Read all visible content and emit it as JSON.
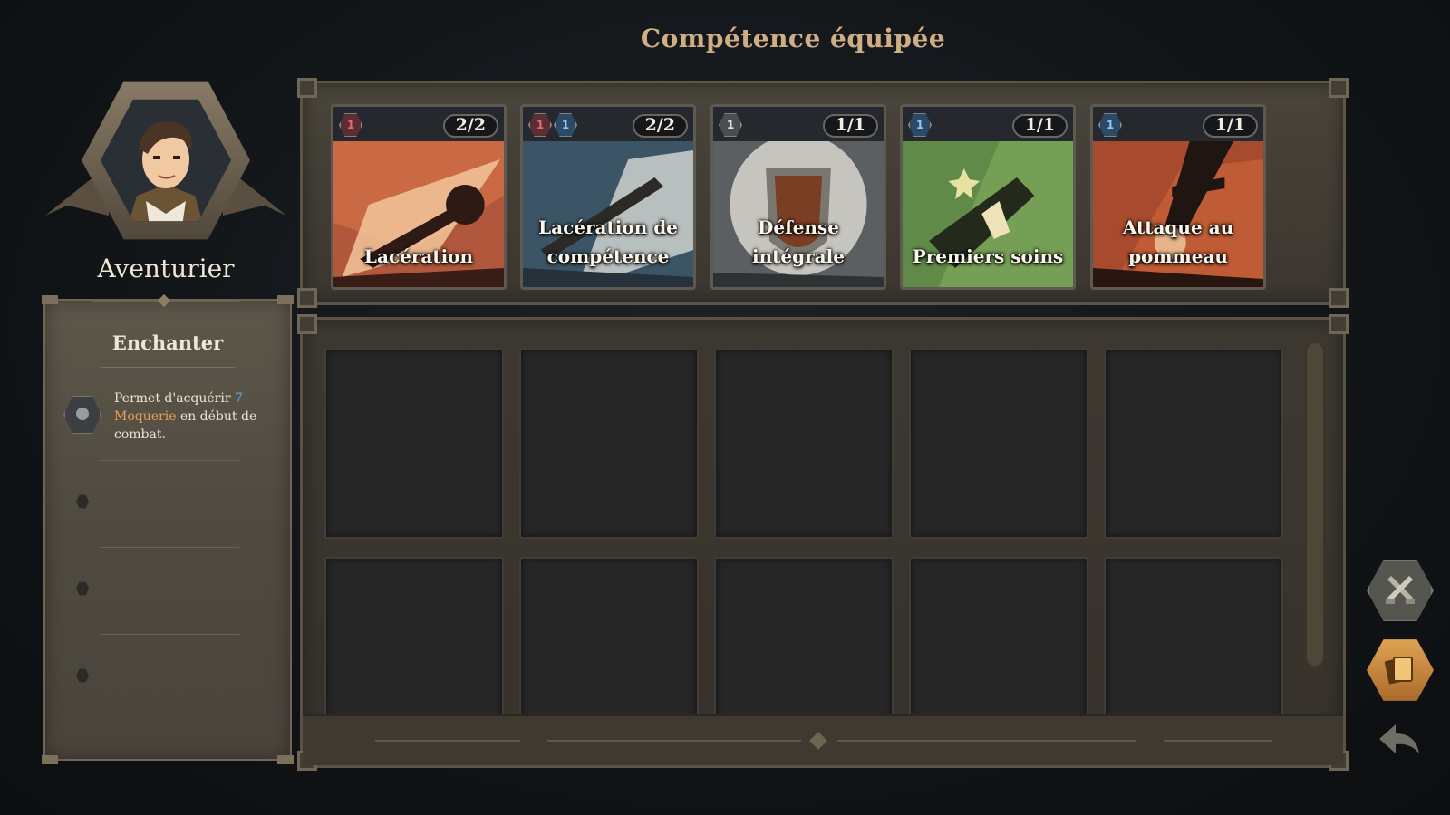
{
  "header": {
    "title": "Compétence équipée"
  },
  "character": {
    "name": "Aventurier"
  },
  "trait_panel": {
    "title": "Enchanter",
    "trait": {
      "icon": "mask-icon",
      "text_before": "Permet d'acquérir ",
      "count": "7",
      "keyword": "Moquerie",
      "text_after": " en début de combat."
    }
  },
  "equipped_cards": [
    {
      "name": "Lacération",
      "count": "2/2",
      "badges": [
        {
          "type": "red",
          "glyph": "1"
        }
      ],
      "theme": "red"
    },
    {
      "name": "Lacération de compétence",
      "count": "2/2",
      "badges": [
        {
          "type": "red",
          "glyph": "1"
        },
        {
          "type": "blue",
          "glyph": "1"
        }
      ],
      "theme": "steel"
    },
    {
      "name": "Défense intégrale",
      "count": "1/1",
      "badges": [
        {
          "type": "grey",
          "glyph": "1"
        }
      ],
      "theme": "shield"
    },
    {
      "name": "Premiers soins",
      "count": "1/1",
      "badges": [
        {
          "type": "blue",
          "glyph": "1"
        }
      ],
      "theme": "green"
    },
    {
      "name": "Attaque au pommeau",
      "count": "1/1",
      "badges": [
        {
          "type": "blue",
          "glyph": "1"
        }
      ],
      "theme": "orange"
    }
  ],
  "side_buttons": {
    "skills": "crossed-swords-icon",
    "cards": "card-deck-icon",
    "back": "back-arrow-icon"
  },
  "colors": {
    "title": "#cfae85",
    "highlight_blue": "#5aa7e6",
    "highlight_orange": "#e4a055",
    "gold_button": "#e0a452"
  }
}
